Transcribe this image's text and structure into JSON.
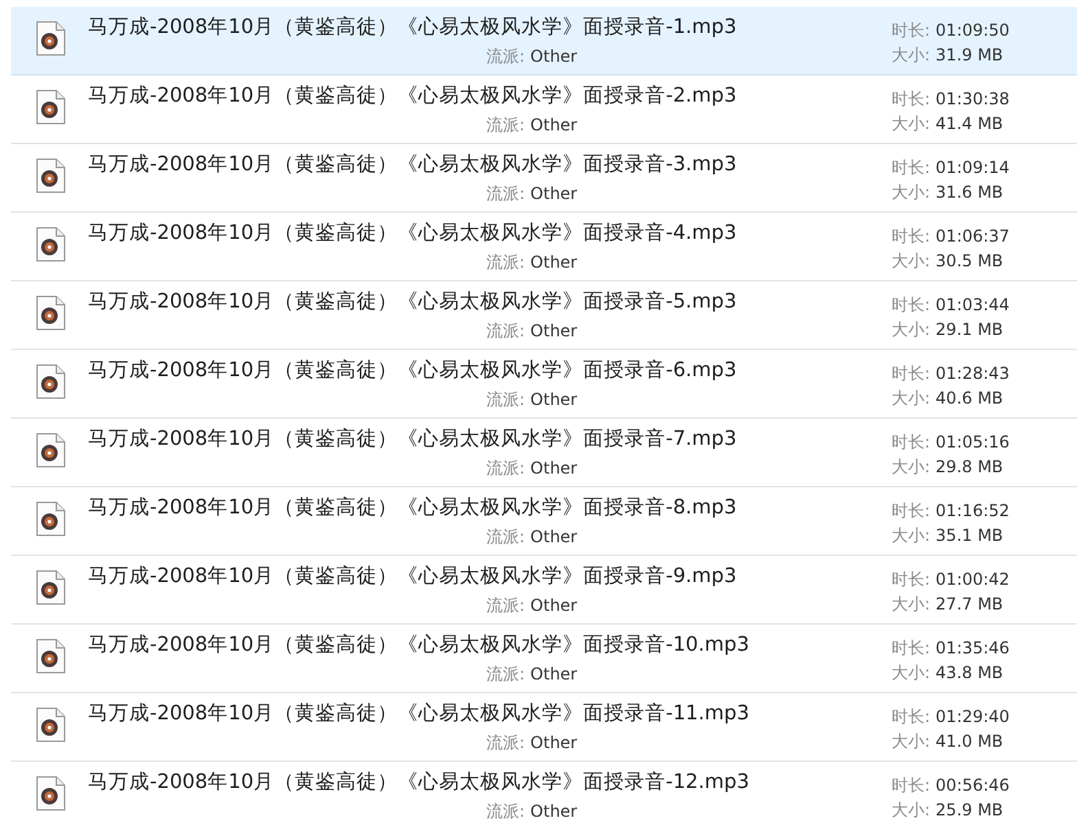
{
  "files": [
    {
      "name": "马万成-2008年10月（黄鉴高徒）《心易太极风水学》面授录音-1.mp3",
      "genre_label": "流派:",
      "genre": "Other",
      "duration_label": "时长:",
      "duration": "01:09:50",
      "size_label": "大小:",
      "size": "31.9 MB",
      "selected": true
    },
    {
      "name": "马万成-2008年10月（黄鉴高徒）《心易太极风水学》面授录音-2.mp3",
      "genre_label": "流派:",
      "genre": "Other",
      "duration_label": "时长:",
      "duration": "01:30:38",
      "size_label": "大小:",
      "size": "41.4 MB",
      "selected": false
    },
    {
      "name": "马万成-2008年10月（黄鉴高徒）《心易太极风水学》面授录音-3.mp3",
      "genre_label": "流派:",
      "genre": "Other",
      "duration_label": "时长:",
      "duration": "01:09:14",
      "size_label": "大小:",
      "size": "31.6 MB",
      "selected": false
    },
    {
      "name": "马万成-2008年10月（黄鉴高徒）《心易太极风水学》面授录音-4.mp3",
      "genre_label": "流派:",
      "genre": "Other",
      "duration_label": "时长:",
      "duration": "01:06:37",
      "size_label": "大小:",
      "size": "30.5 MB",
      "selected": false
    },
    {
      "name": "马万成-2008年10月（黄鉴高徒）《心易太极风水学》面授录音-5.mp3",
      "genre_label": "流派:",
      "genre": "Other",
      "duration_label": "时长:",
      "duration": "01:03:44",
      "size_label": "大小:",
      "size": "29.1 MB",
      "selected": false
    },
    {
      "name": "马万成-2008年10月（黄鉴高徒）《心易太极风水学》面授录音-6.mp3",
      "genre_label": "流派:",
      "genre": "Other",
      "duration_label": "时长:",
      "duration": "01:28:43",
      "size_label": "大小:",
      "size": "40.6 MB",
      "selected": false
    },
    {
      "name": "马万成-2008年10月（黄鉴高徒）《心易太极风水学》面授录音-7.mp3",
      "genre_label": "流派:",
      "genre": "Other",
      "duration_label": "时长:",
      "duration": "01:05:16",
      "size_label": "大小:",
      "size": "29.8 MB",
      "selected": false
    },
    {
      "name": "马万成-2008年10月（黄鉴高徒）《心易太极风水学》面授录音-8.mp3",
      "genre_label": "流派:",
      "genre": "Other",
      "duration_label": "时长:",
      "duration": "01:16:52",
      "size_label": "大小:",
      "size": "35.1 MB",
      "selected": false
    },
    {
      "name": "马万成-2008年10月（黄鉴高徒）《心易太极风水学》面授录音-9.mp3",
      "genre_label": "流派:",
      "genre": "Other",
      "duration_label": "时长:",
      "duration": "01:00:42",
      "size_label": "大小:",
      "size": "27.7 MB",
      "selected": false
    },
    {
      "name": "马万成-2008年10月（黄鉴高徒）《心易太极风水学》面授录音-10.mp3",
      "genre_label": "流派:",
      "genre": "Other",
      "duration_label": "时长:",
      "duration": "01:35:46",
      "size_label": "大小:",
      "size": "43.8 MB",
      "selected": false
    },
    {
      "name": "马万成-2008年10月（黄鉴高徒）《心易太极风水学》面授录音-11.mp3",
      "genre_label": "流派:",
      "genre": "Other",
      "duration_label": "时长:",
      "duration": "01:29:40",
      "size_label": "大小:",
      "size": "41.0 MB",
      "selected": false
    },
    {
      "name": "马万成-2008年10月（黄鉴高徒）《心易太极风水学》面授录音-12.mp3",
      "genre_label": "流派:",
      "genre": "Other",
      "duration_label": "时长:",
      "duration": "00:56:46",
      "size_label": "大小:",
      "size": "25.9 MB",
      "selected": false
    }
  ]
}
